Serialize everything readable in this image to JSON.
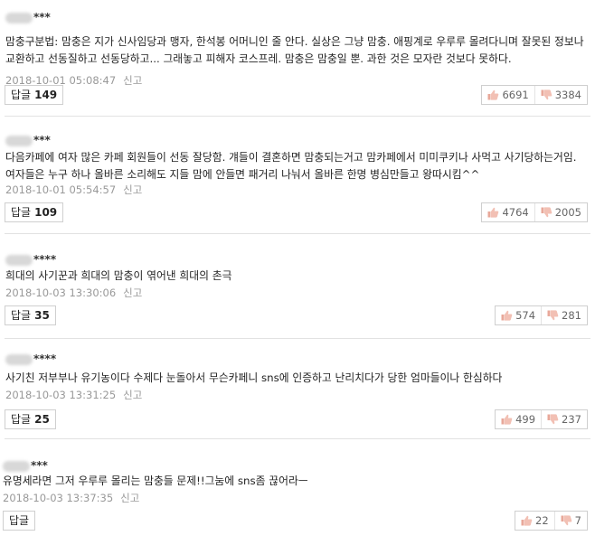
{
  "comments": [
    {
      "author": "***",
      "text": "맘충구분법: 맘충은 지가 신사임당과 맹자, 한석봉 어머니인 줄 안다. 실상은 그냥 맘충. 애핑계로 우루루 몰려다니며 잘못된 정보나 교환하고 선동질하고 선동당하고... 그래놓고 피해자 코스프레. 맘충은 맘충일 뿐. 과한 것은 모자란 것보다 못하다.",
      "date": "2018-10-01 05:08:47",
      "report": "신고",
      "reply_label": "답글",
      "reply_count": "149",
      "likes": "6691",
      "dislikes": "3384"
    },
    {
      "author": "***",
      "text": "다음카페에 여자 많은 카페 회원들이 선동 잘당함. 걔들이 결혼하면 맘충되는거고 맘카페에서 미미쿠키나 사먹고 사기당하는거임. 여자들은 누구 하나 올바른 소리해도 지들 맘에 안들면 패거리 나눠서 올바른 한명 병심만들고 왕따시킴^^",
      "date": "2018-10-01 05:54:57",
      "report": "신고",
      "reply_label": "답글",
      "reply_count": "109",
      "likes": "4764",
      "dislikes": "2005"
    },
    {
      "author": "****",
      "text": "희대의 사기꾼과 희대의 맘충이 엮어낸 희대의 촌극",
      "date": "2018-10-03 13:30:06",
      "report": "신고",
      "reply_label": "답글",
      "reply_count": "35",
      "likes": "574",
      "dislikes": "281"
    },
    {
      "author": "****",
      "text": "사기친 저부부나 유기농이다 수제다 눈돌아서 무슨카페니 sns에 인증하고 난리치다가 당한 엄마들이나 한심하다",
      "date": "2018-10-03 13:31:25",
      "report": "신고",
      "reply_label": "답글",
      "reply_count": "25",
      "likes": "499",
      "dislikes": "237"
    },
    {
      "author": "***",
      "text": "유명세라면 그저 우루루 몰리는 맘충들 문제!!그눔에 sns좀 끊어라ㅡ",
      "date": "2018-10-03 13:37:35",
      "report": "신고",
      "reply_label": "답글",
      "reply_count": "",
      "likes": "22",
      "dislikes": "7"
    }
  ]
}
